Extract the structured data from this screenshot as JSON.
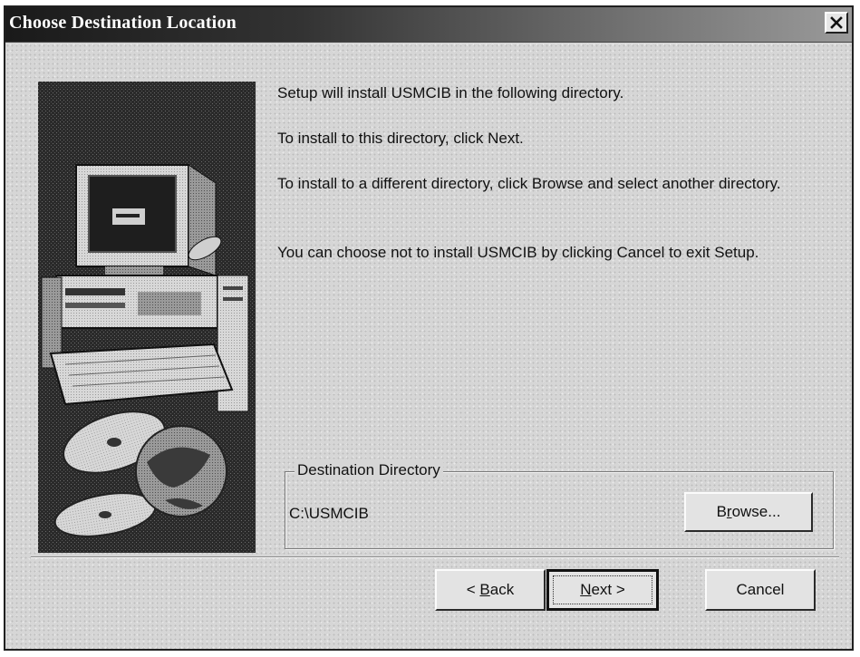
{
  "window": {
    "title": "Choose Destination Location"
  },
  "icons": {
    "close": "close-icon",
    "illustration": "computer-setup-illustration"
  },
  "messages": [
    "Setup will install USMCIB in the following directory.",
    "To install to this directory, click Next.",
    "To install to a different directory, click Browse and select another directory.",
    "You can choose not to install USMCIB by clicking Cancel to exit Setup."
  ],
  "destination": {
    "group_label": "Destination Directory",
    "path": "C:\\USMCIB",
    "browse_label_pre": "B",
    "browse_label_u": "r",
    "browse_label_post": "owse..."
  },
  "buttons": {
    "back_pre": "< ",
    "back_u": "B",
    "back_post": "ack",
    "next_u": "N",
    "next_post": "ext >",
    "cancel": "Cancel"
  }
}
